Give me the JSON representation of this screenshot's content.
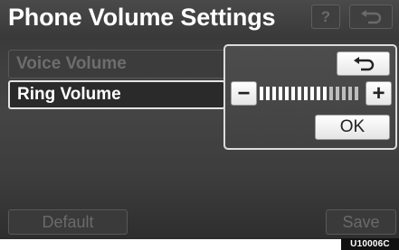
{
  "header": {
    "title": "Phone Volume Settings",
    "help_label": "?",
    "back_icon": "back-arrow-icon"
  },
  "list": {
    "voice_volume_label": "Voice Volume",
    "ring_volume_label": "Ring Volume"
  },
  "panel": {
    "back_icon": "back-arrow-icon",
    "minus_label": "−",
    "plus_label": "+",
    "volume_level": 11,
    "volume_max": 16,
    "ok_label": "OK"
  },
  "footer": {
    "default_label": "Default",
    "save_label": "Save"
  },
  "figure_code": "U10006C"
}
